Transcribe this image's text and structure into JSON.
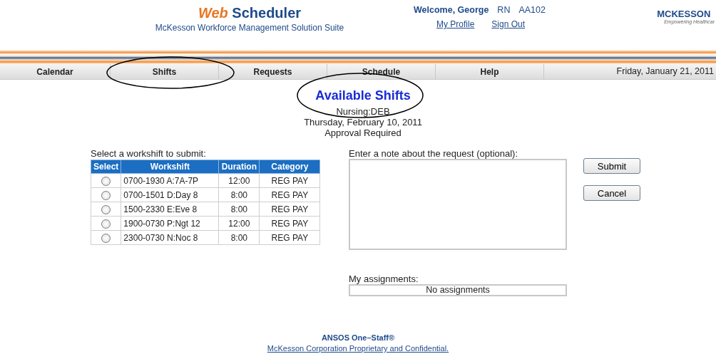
{
  "header": {
    "app_title_part1": "Web",
    "app_title_part2": "Scheduler",
    "subtitle": "McKesson Workforce Management Solution Suite",
    "welcome": "Welcome, George",
    "role": "RN",
    "user_code": "AA102",
    "links": [
      "My Profile",
      "Sign Out"
    ],
    "logo": "MCKESSON",
    "logo_tagline": "Empowering Healthcar"
  },
  "nav": {
    "tabs": [
      {
        "label": "Calendar",
        "selected": false
      },
      {
        "label": "Shifts",
        "selected": false
      },
      {
        "label": "Requests",
        "selected": false
      },
      {
        "label": "Schedule",
        "selected": false
      },
      {
        "label": "Help",
        "selected": false
      }
    ],
    "date": "Friday, January 21, 2011"
  },
  "page": {
    "title": "Available Shifts",
    "unit": "Nursing:DEB",
    "date": "Thursday, February 10, 2011",
    "approval": "Approval Required"
  },
  "shifts": {
    "label": "Select a workshift to submit:",
    "columns": [
      "Select",
      "Workshift",
      "Duration",
      "Category"
    ],
    "rows": [
      {
        "selected": false,
        "workshift": "0700-1930 A:7A-7P",
        "duration": "12:00",
        "category": "REG PAY"
      },
      {
        "selected": false,
        "workshift": "0700-1501 D:Day 8",
        "duration": "8:00",
        "category": "REG PAY"
      },
      {
        "selected": false,
        "workshift": "1500-2330 E:Eve 8",
        "duration": "8:00",
        "category": "REG PAY"
      },
      {
        "selected": false,
        "workshift": "1900-0730 P:Ngt 12",
        "duration": "12:00",
        "category": "REG PAY"
      },
      {
        "selected": false,
        "workshift": "2300-0730 N:Noc 8",
        "duration": "8:00",
        "category": "REG PAY"
      }
    ]
  },
  "note": {
    "label": "Enter a note about the request (optional):"
  },
  "buttons": [
    "Submit",
    "Cancel"
  ],
  "assignments": {
    "label": "My assignments:",
    "value": "No assignments"
  },
  "footer": {
    "product": "ANSOS One–Staff®",
    "notice": "McKesson Corporation Proprietary and Confidential."
  }
}
